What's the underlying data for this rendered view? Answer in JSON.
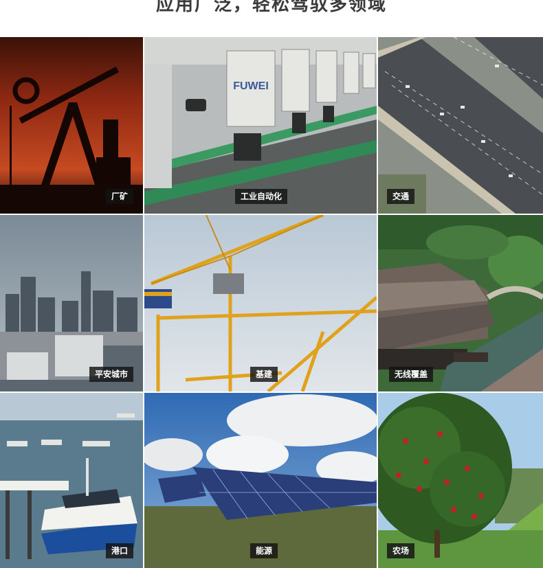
{
  "header": {
    "title": "应用广泛，轻松驾驭多领域"
  },
  "tiles": [
    {
      "label": "厂矿"
    },
    {
      "label": "工业自动化"
    },
    {
      "label": "交通"
    },
    {
      "label": "平安城市"
    },
    {
      "label": "基建"
    },
    {
      "label": "无线覆盖"
    },
    {
      "label": "港口"
    },
    {
      "label": "能源"
    },
    {
      "label": "农场"
    }
  ],
  "machine_brand": "FUWEI"
}
